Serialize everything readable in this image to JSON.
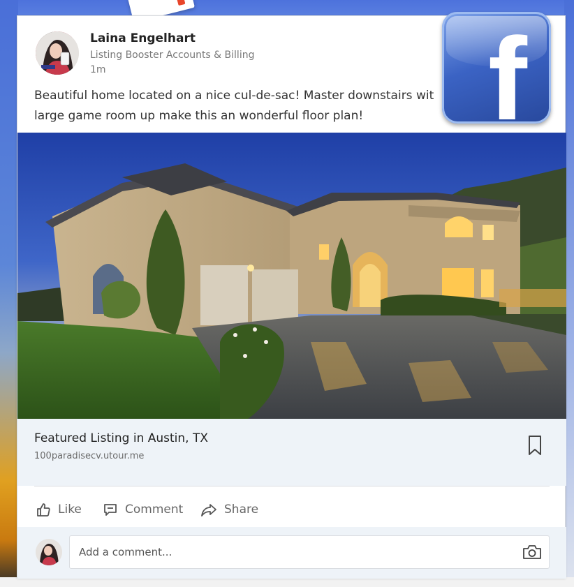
{
  "post": {
    "author": "Laina Engelhart",
    "page": "Listing Booster Accounts & Billing",
    "time": "1m",
    "text_line1": "Beautiful home located on a nice cul-de-sac! Master downstairs wit",
    "text_line2": "large game room up make this an wonderful floor plan!"
  },
  "brand_logo": {
    "icon": "facebook-logo-icon",
    "glyph": "f",
    "color": "#3b5998"
  },
  "photo": {
    "subject": "house-photo"
  },
  "link": {
    "title": "Featured Listing in Austin, TX",
    "url": "100paradisecv.utour.me"
  },
  "actions": {
    "like": "Like",
    "comment": "Comment",
    "share": "Share"
  },
  "comment_box": {
    "placeholder": "Add a comment..."
  },
  "colors": {
    "background": "#4a6fd8",
    "card": "#ffffff",
    "link_box": "#eef3f8",
    "text_secondary": "#787878"
  }
}
